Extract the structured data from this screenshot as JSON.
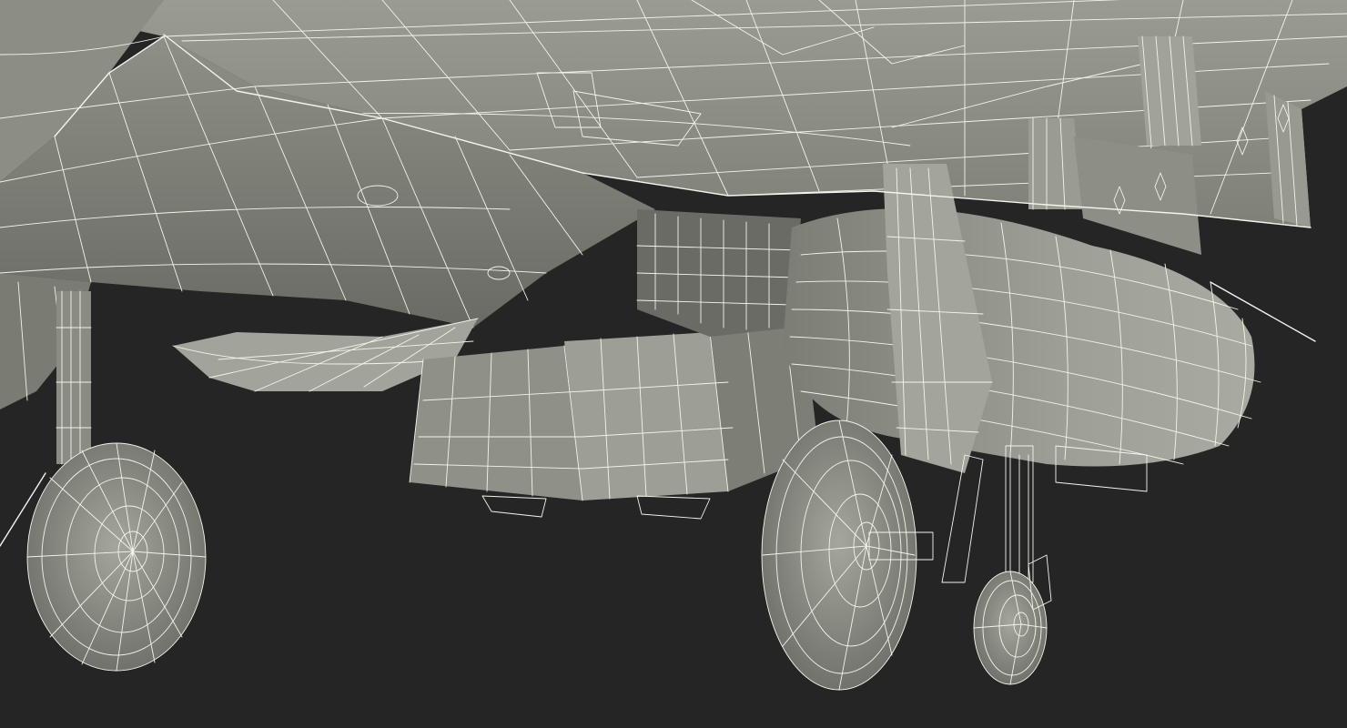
{
  "scene": {
    "subject": "aircraft-underside-wireframe-render",
    "background_color": "#252525",
    "surface_color": "#8a8b82",
    "surface_dark_color": "#5d5e57",
    "surface_light_color": "#a3a49b",
    "wire_color": "#f4f3ec"
  }
}
